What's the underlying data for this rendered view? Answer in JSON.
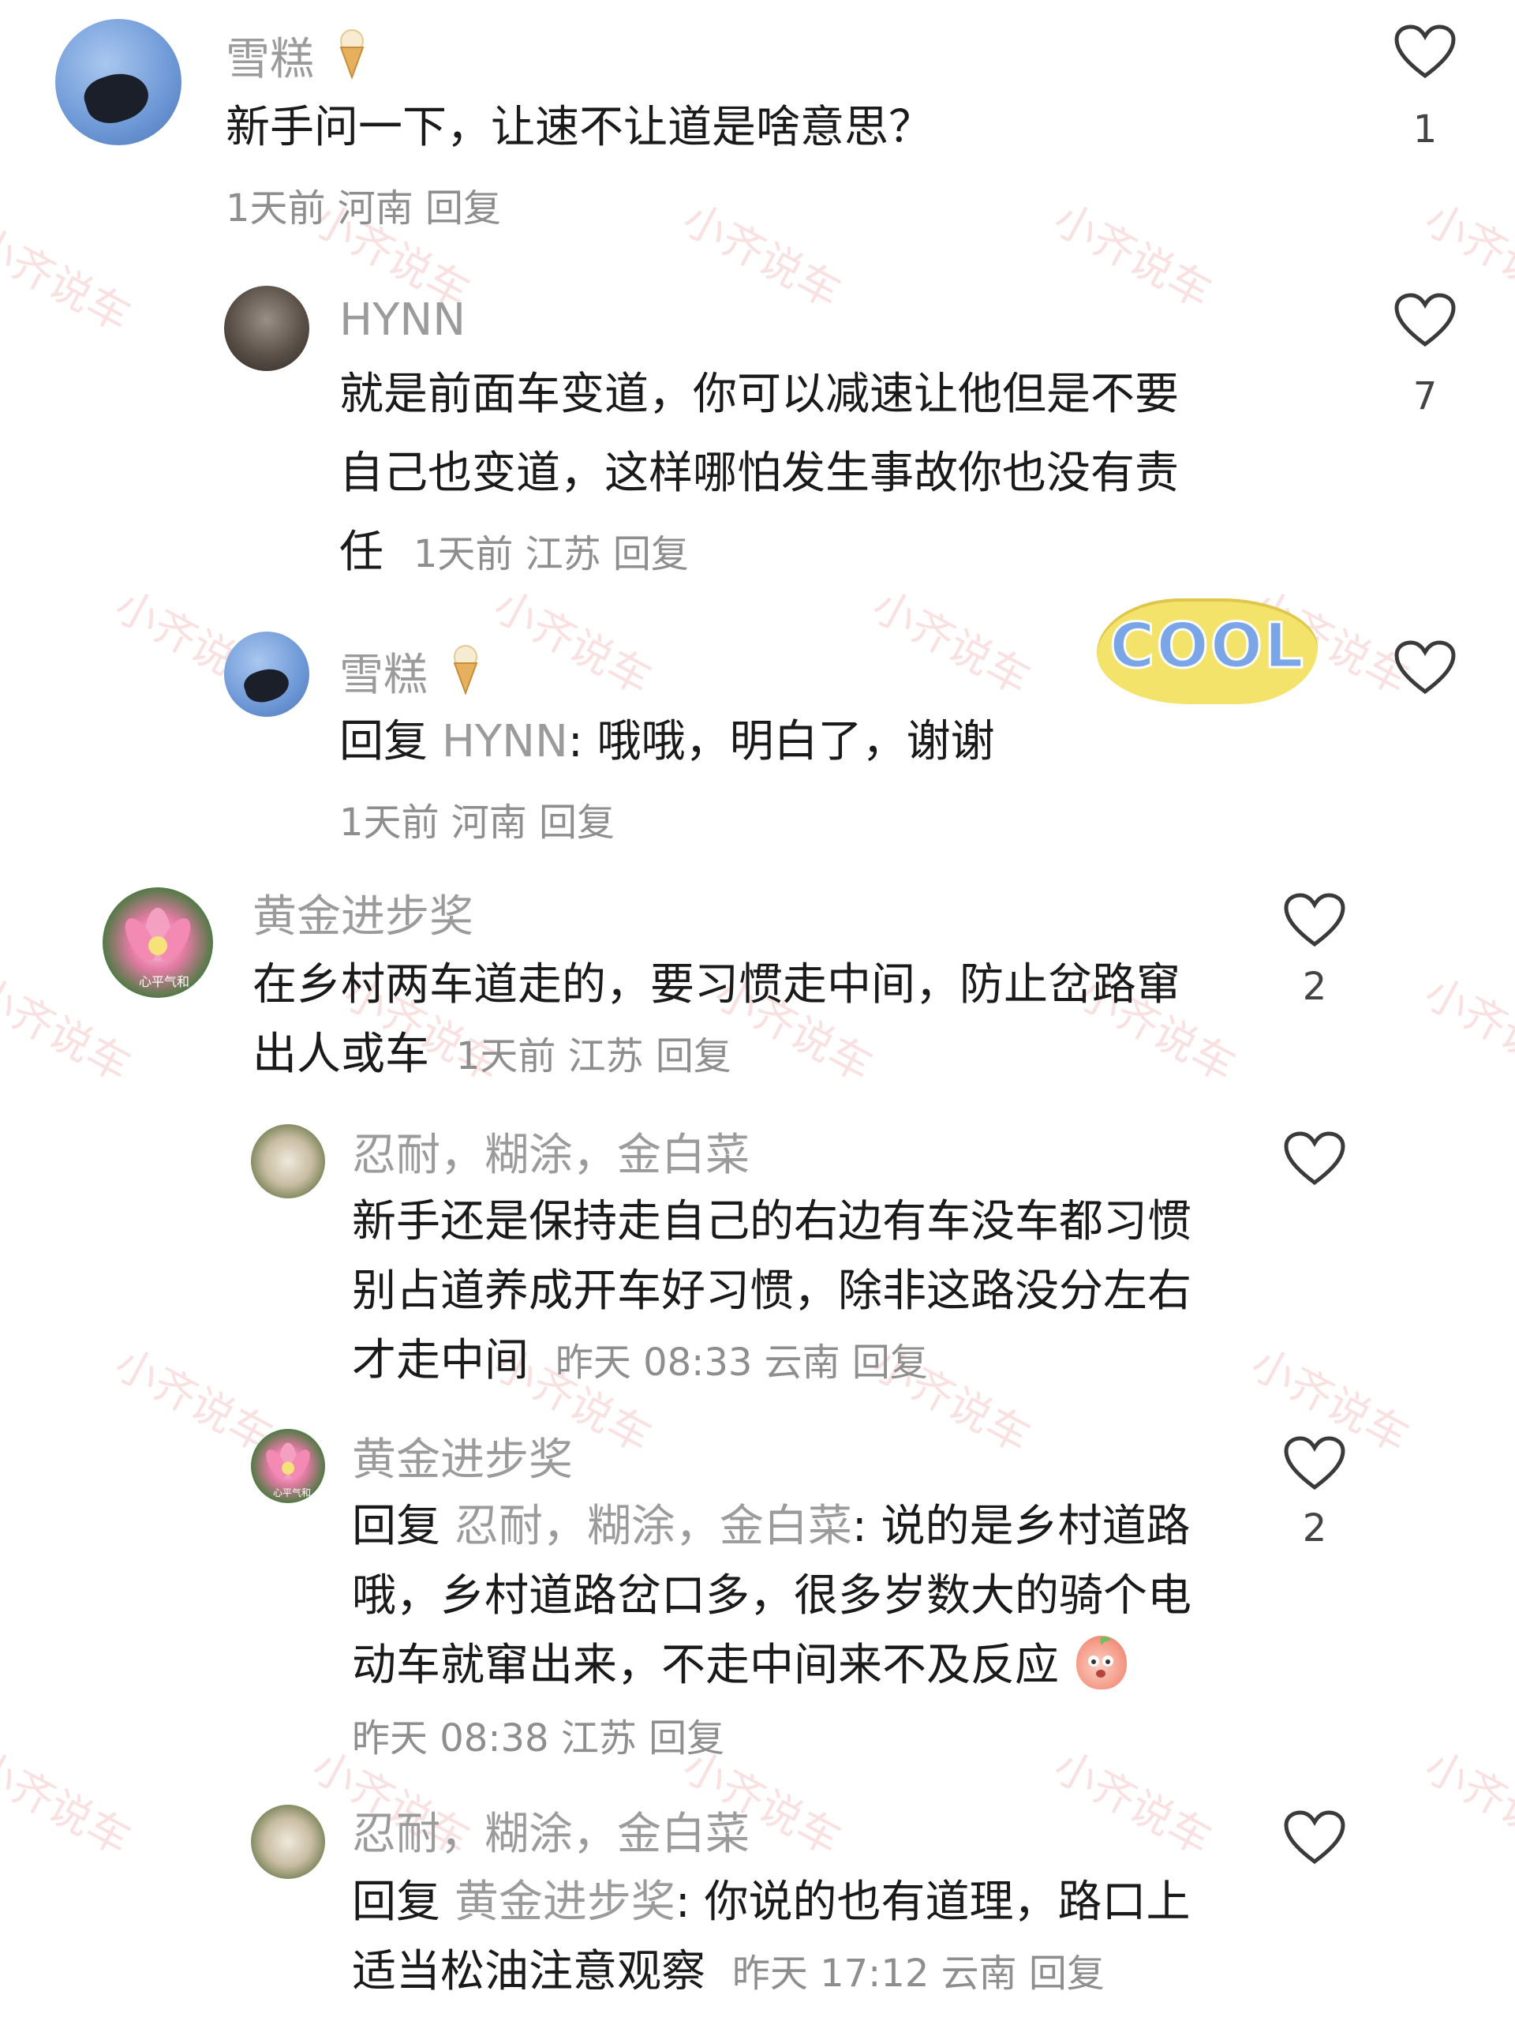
{
  "watermark": "小齐说车",
  "comments": [
    {
      "user": "雪糕",
      "text": "新手问一下，让速不让道是啥意思？",
      "meta": "1天前 河南 回复",
      "likes": "1"
    },
    {
      "user": "HYNN",
      "text_line1": "就是前面车变道，你可以减速让他但是不要",
      "text_line2": "自己也变道，这样哪怕发生事故你也没有责",
      "text_line3": "任",
      "meta": "1天前 江苏 回复",
      "likes": "7"
    },
    {
      "user": "雪糕",
      "reply_prefix": "回复",
      "reply_target": "HYNN",
      "text": ": 哦哦，明白了，谢谢",
      "sticker": "COOL",
      "meta": "1天前 河南 回复"
    },
    {
      "user": "黄金进步奖",
      "avatar_label": "心平气和",
      "text_line1": "在乡村两车道走的，要习惯走中间，防止岔路窜",
      "text_line2": "出人或车",
      "meta": "1天前 江苏 回复",
      "likes": "2"
    },
    {
      "user": "忍耐，糊涂，金白菜",
      "text_line1": "新手还是保持走自己的右边有车没车都习惯",
      "text_line2": "别占道养成开车好习惯，除非这路没分左右",
      "text_line3": "才走中间",
      "meta": "昨天 08:33 云南 回复"
    },
    {
      "user": "黄金进步奖",
      "avatar_label": "心平气和",
      "reply_prefix": "回复",
      "reply_target": "忍耐，糊涂，金白菜",
      "text_line1": ": 说的是乡村道路",
      "text_line2": "哦，乡村道路岔口多，很多岁数大的骑个电",
      "text_line3": "动车就窜出来，不走中间来不及反应",
      "meta": "昨天 08:38 江苏 回复",
      "likes": "2"
    },
    {
      "user": "忍耐，糊涂，金白菜",
      "reply_prefix": "回复",
      "reply_target": "黄金进步奖",
      "text_line1": ": 你说的也有道理，路口上",
      "text_line2": "适当松油注意观察",
      "meta": "昨天 17:12 云南 回复"
    }
  ]
}
